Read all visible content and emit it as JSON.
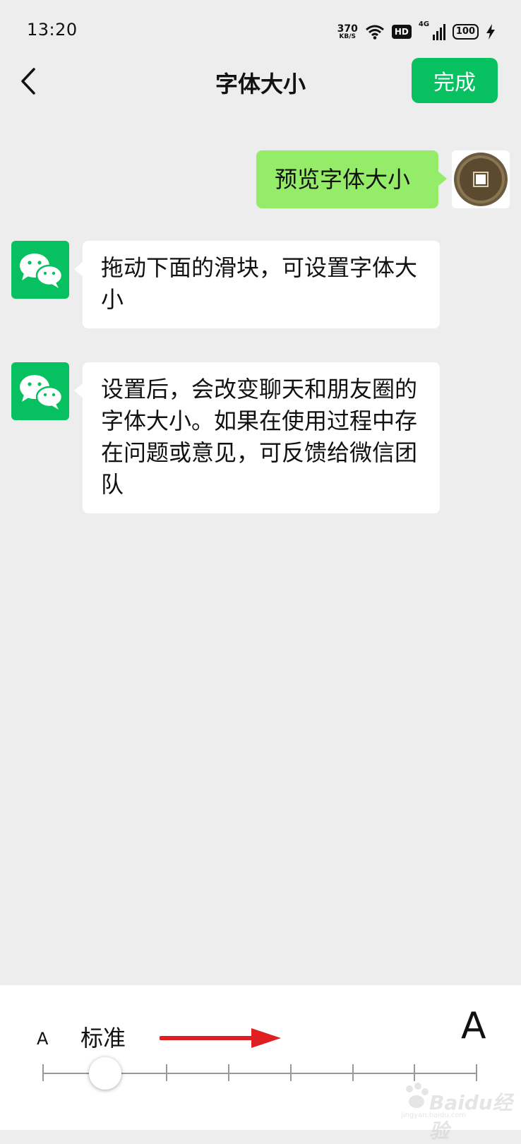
{
  "status_bar": {
    "time": "13:20",
    "net_speed_value": "370",
    "net_speed_unit": "KB/S",
    "hd_label": "HD",
    "network_label": "4G",
    "battery_level": "100"
  },
  "nav": {
    "title": "字体大小",
    "done_label": "完成"
  },
  "chat": {
    "user_message": "预览字体大小",
    "bot_messages": [
      "拖动下面的滑块，可设置字体大小",
      "设置后，会改变聊天和朋友圈的字体大小。如果在使用过程中存在问题或意见，可反馈给微信团队"
    ]
  },
  "font_slider": {
    "small_label": "A",
    "large_label": "A",
    "current_level_label": "标准",
    "total_steps": 8,
    "current_step": 2
  },
  "watermark": {
    "text": "Baidu经验",
    "sub": "jingyan.baidu.com"
  },
  "colors": {
    "accent": "#07c160",
    "user_bubble": "#95ec69",
    "background": "#ededed",
    "arrow": "#e02020"
  }
}
